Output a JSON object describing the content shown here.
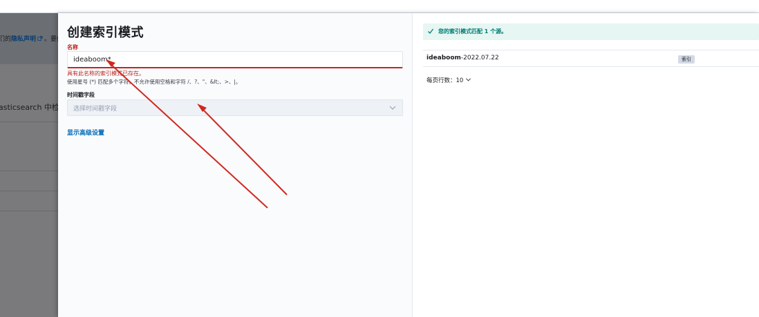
{
  "background_page": {
    "banner_text_prefix": "们的",
    "banner_link": "隐私声明",
    "banner_text_suffix": "。要停",
    "body_text": "asticsearch 中检索数"
  },
  "flyout": {
    "title": "创建索引模式",
    "name_field": {
      "label": "名称",
      "value": "ideaboom*",
      "error": "具有此名称的索引模式已存在。",
      "help": "使用星号 (*) 匹配多个字符。不允许使用空格和字符 /、?、\"、&lt;、>、|。"
    },
    "timestamp_field": {
      "label": "时间戳字段",
      "placeholder": "选择时间戳字段"
    },
    "advanced_link": "显示高级设置"
  },
  "results": {
    "callout": "您的索引模式匹配 1 个源。",
    "rows": [
      {
        "name_bold": "ideaboom",
        "name_rest": "-2022.07.22",
        "badge": "索引"
      }
    ],
    "rows_per_page_label": "每页行数：",
    "rows_per_page_value": "10"
  },
  "colors": {
    "danger": "#bd271e",
    "success": "#017d73",
    "link": "#006bb8",
    "annotation_arrow": "#d0281f"
  },
  "icons": {
    "callout": "check-icon",
    "select": "chevron-down-icon",
    "external_link": "external-link-icon"
  }
}
